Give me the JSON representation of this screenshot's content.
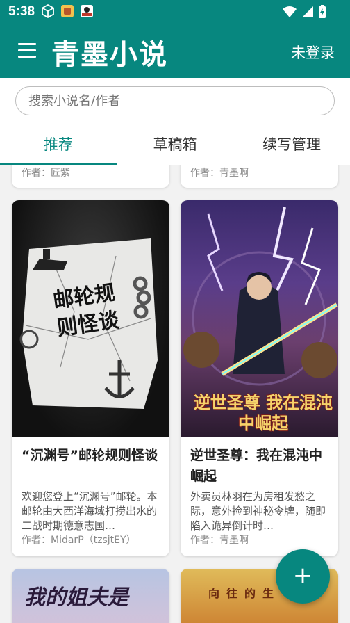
{
  "status_bar": {
    "time": "5:38",
    "icons_left": [
      "cube-icon",
      "app-badge-icon",
      "app-badge2-icon"
    ],
    "icons_right": [
      "wifi-icon",
      "signal-icon",
      "battery-charging-icon"
    ]
  },
  "app_bar": {
    "title": "青墨小说",
    "login_label": "未登录"
  },
  "search": {
    "placeholder": "搜索小说名/作者",
    "value": ""
  },
  "tabs": [
    {
      "label": "推荐",
      "active": true
    },
    {
      "label": "草稿箱",
      "active": false
    },
    {
      "label": "续写管理",
      "active": false
    }
  ],
  "partial_cards_top": [
    {
      "author": "作者：匠紫"
    },
    {
      "author": "作者：青墨啊"
    }
  ],
  "cards": [
    {
      "cover_text": "邮轮规则怪谈",
      "title": "“沉渊号”邮轮规则怪谈",
      "description": "欢迎您登上“沉渊号”邮轮。本邮轮由大西洋海域打捞出水的二战时期德意志国…",
      "author": "作者：MidarP（tzsjtEY）"
    },
    {
      "cover_text": "逆世圣尊 我在混沌中崛起",
      "title": "逆世圣尊：我在混沌中崛起",
      "description": "外卖员林羽在为房租发愁之际，意外捡到神秘令牌，随即陷入诡异倒计时…",
      "author": "作者：青墨啊"
    }
  ],
  "partial_cards_bottom": [
    {
      "cover_text": "我的姐夫是"
    },
    {
      "cover_text": "向往的生"
    }
  ],
  "fab": {
    "label": "+"
  },
  "colors": {
    "primary": "#07877f",
    "background": "#f2f2f2"
  }
}
